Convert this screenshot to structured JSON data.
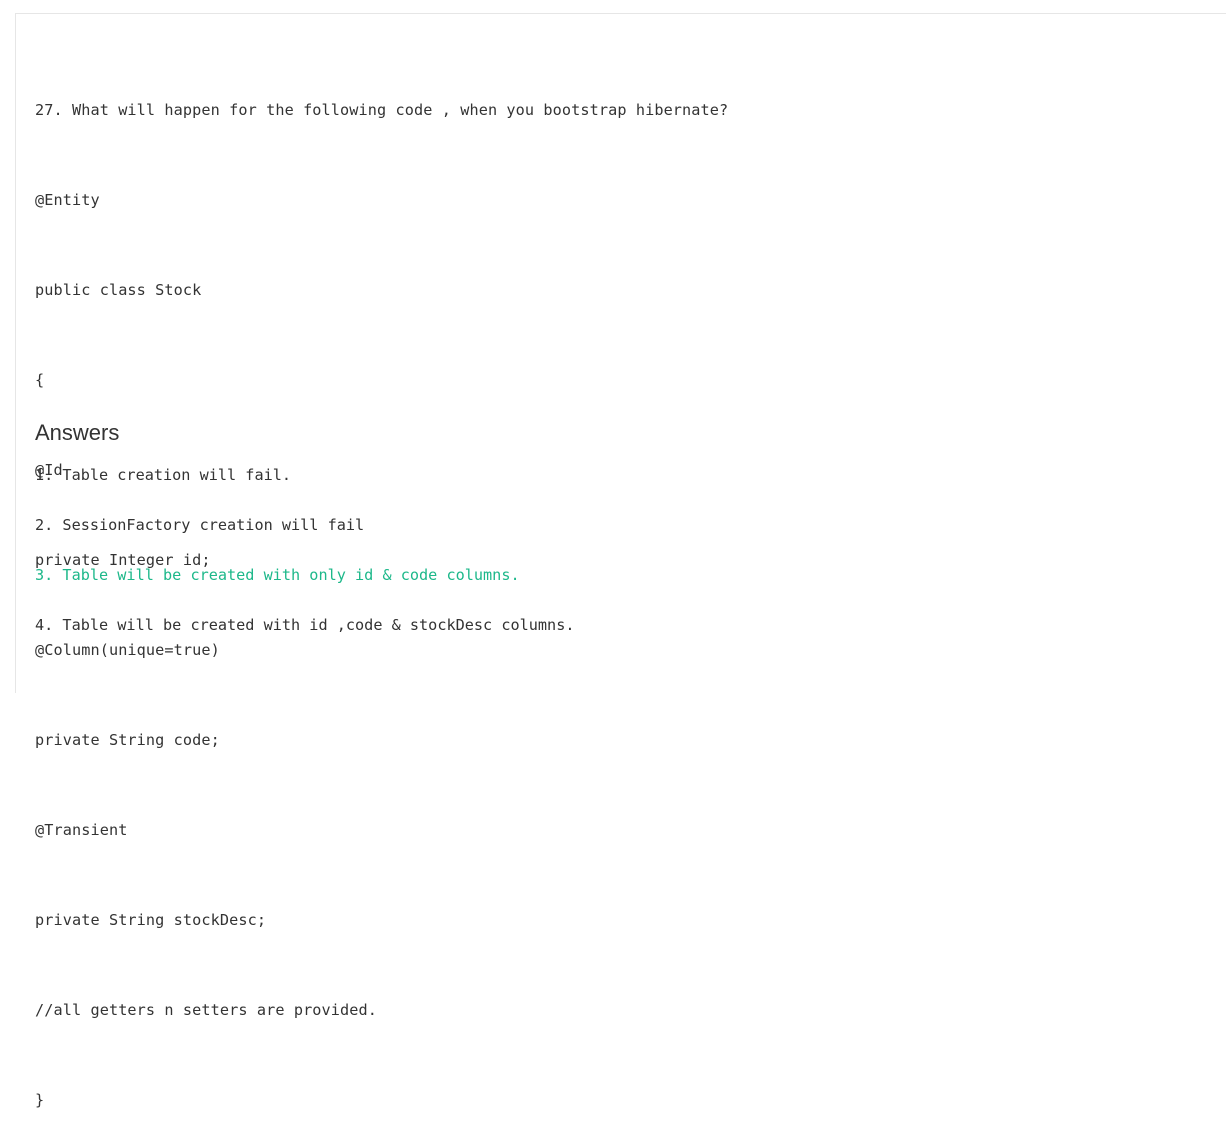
{
  "question": {
    "lines": [
      "27. What will happen for the following code , when you bootstrap hibernate?",
      "@Entity",
      "public class Stock",
      "{",
      "@Id",
      "private Integer id;",
      "@Column(unique=true)",
      "private String code;",
      "@Transient",
      "private String stockDesc;",
      "//all getters n setters are provided.",
      "}"
    ]
  },
  "answers": {
    "heading": "Answers",
    "options": [
      {
        "text": "1. Table creation will fail.",
        "correct": false
      },
      {
        "text": "2. SessionFactory creation will fail",
        "correct": false
      },
      {
        "text": "3. Table will be created with only id & code columns.",
        "correct": true
      },
      {
        "text": "4. Table will be created with id ,code & stockDesc columns.",
        "correct": false
      }
    ],
    "correct_color": "#1db88a",
    "text_color": "#333333"
  }
}
